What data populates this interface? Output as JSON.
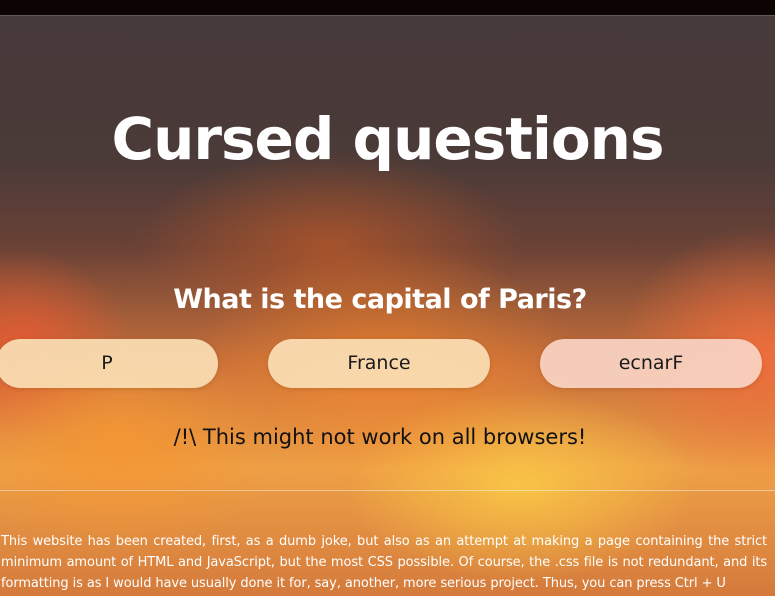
{
  "header": {
    "title": "Cursed questions"
  },
  "quiz": {
    "question": "What is the capital of Paris?",
    "answers": [
      "P",
      "France",
      "ecnarF"
    ],
    "warning": "/!\\ This might not work on all browsers!"
  },
  "footer": {
    "text": "This website has been created, first, as a dumb joke, but also as an attempt at making a page containing the strict minimum amount of HTML and JavaScript, but the most CSS possible. Of course, the .css file is not redundant, and its formatting is as I would have usually done it for, say, another, more serious project. Thus, you can press Ctrl + U"
  },
  "colors": {
    "top_strip": "#0d0302",
    "answer_fill": "#fadeb4",
    "title_text": "#ffffff",
    "warning_text": "#111111"
  }
}
